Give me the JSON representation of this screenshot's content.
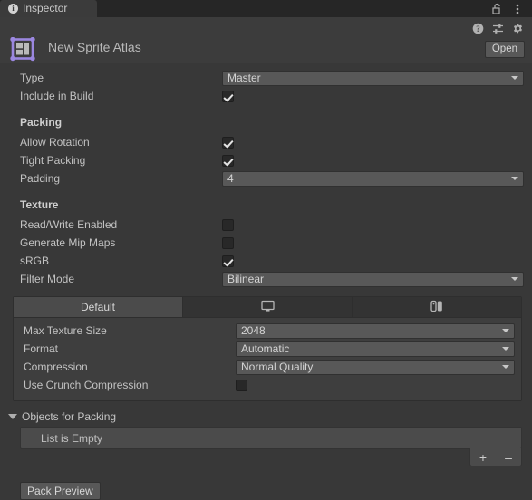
{
  "window": {
    "tab_label": "Inspector",
    "tab_icon": "info-circle-icon",
    "lock_icon": "lock-open-icon",
    "menu_icon": "kebab-menu-icon"
  },
  "header": {
    "asset_icon": "sprite-atlas-icon",
    "title": "New Sprite Atlas",
    "help_icon": "help-question-icon",
    "preset_icon": "preset-sliders-icon",
    "gear_icon": "gear-icon",
    "open_label": "Open"
  },
  "general": {
    "type_label": "Type",
    "type_value": "Master",
    "include_label": "Include in Build",
    "include_checked": true
  },
  "packing": {
    "section_label": "Packing",
    "allow_rotation_label": "Allow Rotation",
    "allow_rotation_checked": true,
    "tight_packing_label": "Tight Packing",
    "tight_packing_checked": true,
    "padding_label": "Padding",
    "padding_value": "4"
  },
  "texture": {
    "section_label": "Texture",
    "read_write_label": "Read/Write Enabled",
    "read_write_checked": false,
    "mipmaps_label": "Generate Mip Maps",
    "mipmaps_checked": false,
    "srgb_label": "sRGB",
    "srgb_checked": true,
    "filter_mode_label": "Filter Mode",
    "filter_mode_value": "Bilinear"
  },
  "platform": {
    "tabs": [
      {
        "label": "Default",
        "icon": "",
        "active": true
      },
      {
        "label": "",
        "icon": "desktop-monitor-icon",
        "active": false
      },
      {
        "label": "",
        "icon": "nintendo-switch-icon",
        "active": false
      }
    ],
    "max_texture_size_label": "Max Texture Size",
    "max_texture_size_value": "2048",
    "format_label": "Format",
    "format_value": "Automatic",
    "compression_label": "Compression",
    "compression_value": "Normal Quality",
    "crunch_label": "Use Crunch Compression",
    "crunch_checked": false
  },
  "objects_for_packing": {
    "foldout_label": "Objects for Packing",
    "empty_label": "List is Empty",
    "add_label": "+",
    "remove_label": "–"
  },
  "footer": {
    "pack_preview_label": "Pack Preview"
  },
  "colors": {
    "window_bg": "#383838",
    "header_bg": "#3c3c3c",
    "field_bg": "#585858",
    "accent_rail": "#2b5c8a",
    "asset_icon_purple": "#9b87e0"
  }
}
